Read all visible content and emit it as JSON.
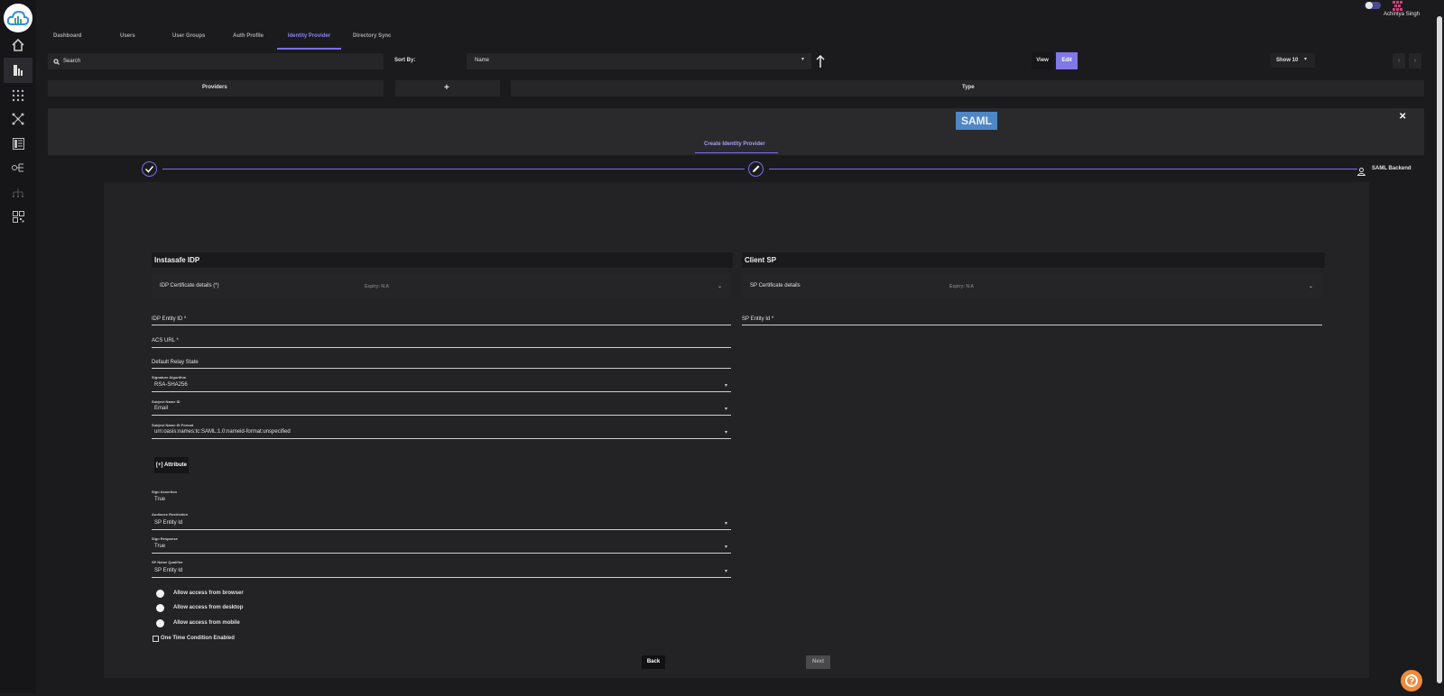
{
  "sidebar": {
    "items": [
      "home-icon",
      "users-icon",
      "grid-icon",
      "network-icon",
      "list-icon",
      "settings-flow-icon",
      "sitemap-icon",
      "apps-icon"
    ]
  },
  "header": {
    "user_name": "Achintya Singh"
  },
  "tabs": [
    "Dashboard",
    "Users",
    "User Groups",
    "Auth Profile",
    "Identity Provider",
    "Directory Sync"
  ],
  "toolbar": {
    "search_placeholder": "Search",
    "sort_by_label": "Sort By:",
    "sort_value": "Name",
    "view_label": "View",
    "edit_label": "Edit",
    "show_label": "Show 10"
  },
  "columns": {
    "providers": "Providers",
    "add": "+",
    "type": "Type"
  },
  "panel": {
    "badge": "SAML",
    "close": "✕",
    "tab_label": "Create Identity Provider",
    "step_label": "SAML Backend"
  },
  "left": {
    "title": "Instasafe IDP",
    "cert_label": "IDP Certificate details (*)",
    "cert_expiry": "Expiry: N.A",
    "idp_entity_id": "IDP Entity ID *",
    "acs_url": "ACS URL *",
    "relay_state": "Default Relay State",
    "sig_alg_label": "Signature Algorithm",
    "sig_alg_value": "RSA-SHA256",
    "subject_name_id_label": "Subject Name ID",
    "subject_name_id_value": "Email",
    "subject_format_label": "Subject Name ID Format",
    "subject_format_value": "urn:oasis:names:tc:SAML:1.0:nameid-format:unspecified",
    "attribute_button": "[+] Attribute",
    "sign_assertion_label": "Sign Assertion",
    "sign_assertion_value": "True",
    "audience_label": "Audience Restriction",
    "audience_value": "SP Entity Id",
    "sign_response_label": "Sign Response",
    "sign_response_value": "True",
    "sp_name_qualifier_label": "SP Name Qualifier",
    "sp_name_qualifier_value": "SP Entity Id",
    "allow_browser": "Allow access from browser",
    "allow_desktop": "Allow access from desktop",
    "allow_mobile": "Allow access from mobile",
    "one_time": "One Time Condition Enabled"
  },
  "right": {
    "title": "Client SP",
    "cert_label": "SP Certificate details",
    "cert_expiry": "Expiry: N.A",
    "sp_entity_id": "SP Entity Id *"
  },
  "footer": {
    "back": "Back",
    "next": "Next"
  },
  "colors": {
    "accent": "#7a6fe6",
    "badge": "#4f86c6",
    "help": "#f08a3c"
  }
}
